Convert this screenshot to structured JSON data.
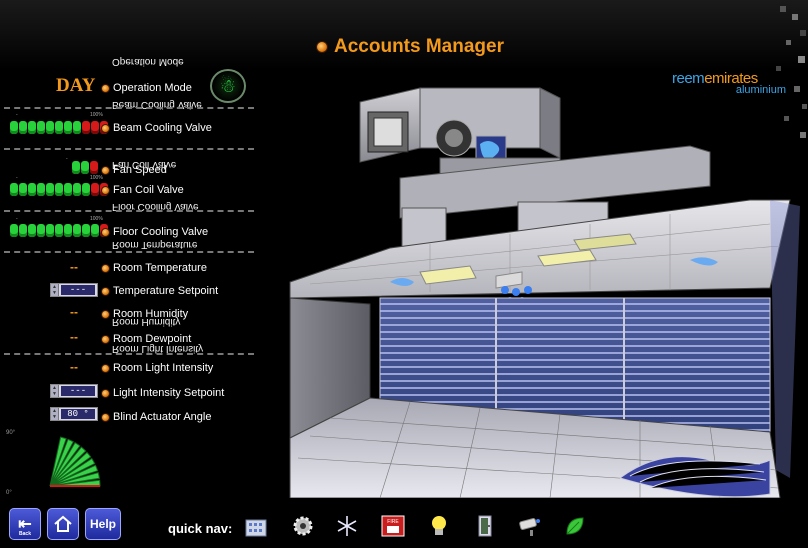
{
  "header": {
    "title": "Accounts Manager"
  },
  "brand": {
    "name_part1": "reem",
    "name_part2": "emirates",
    "subtitle": "aluminium"
  },
  "panel": {
    "day_label": "DAY",
    "reflections": {
      "operation_mode": "Operation Mode",
      "beam_cooling_valve": "Beam Cooling Valve",
      "fan_speed": "Fan Coil Valve",
      "floor_cooling_valve": "Floor Cooling Valve",
      "room_temperature": "Room Temperature",
      "room_humidity": "Room Humidity",
      "room_light_intensity": "Room Light Intensity"
    },
    "rows": {
      "operation_mode": "Operation Mode",
      "beam_cooling_valve": "Beam Cooling Valve",
      "fan_speed": "Fan Speed",
      "fan_coil_valve": "Fan Coil Valve",
      "floor_cooling_valve": "Floor Cooling Valve",
      "room_temperature": "Room Temperature",
      "temperature_setpoint": "Temperature Setpoint",
      "room_humidity": "Room Humidity",
      "room_dewpoint": "Room Dewpoint",
      "room_light_intensity": "Room Light Intensity",
      "light_intensity_setpoint": "Light Intensity Setpoint",
      "blind_actuator_angle": "Blind Actuator Angle"
    },
    "values": {
      "room_temperature": "--",
      "temperature_setpoint": "---",
      "room_humidity": "--",
      "room_dewpoint": "--",
      "room_light_intensity": "--",
      "light_intensity_setpoint": "---",
      "blind_actuator_angle": "80 °"
    },
    "gauge_ticks": {
      "top": "90°",
      "bottom": "0°"
    },
    "beam_scale": "100%",
    "fan_scale": "100%",
    "floor_scale": "100%"
  },
  "levels": {
    "beam_cooling_valve": {
      "segments_total": 11,
      "segments_green": 8
    },
    "fan_speed": {
      "segments_total": 3,
      "segments_green": 2
    },
    "fan_coil_valve": {
      "segments_total": 11,
      "segments_green": 9
    },
    "floor_cooling_valve": {
      "segments_total": 11,
      "segments_green": 10
    },
    "blind_angle_deg": 80
  },
  "footer": {
    "back_label": "Back",
    "help_label": "Help",
    "quicknav_label": "quick nav:",
    "icons": [
      "building-icon",
      "gear-icon",
      "snowflake-icon",
      "fire-alarm-icon",
      "light-bulb-icon",
      "door-icon",
      "camera-icon",
      "leaf-icon"
    ],
    "fire_icon_text": "FIRE"
  },
  "colors": {
    "accent": "#f39a1c",
    "brand_blue": "#3aa6e8",
    "bar_green": "#27d23a",
    "bar_red": "#d61a1a",
    "button_blue": "#2d3ab8"
  }
}
